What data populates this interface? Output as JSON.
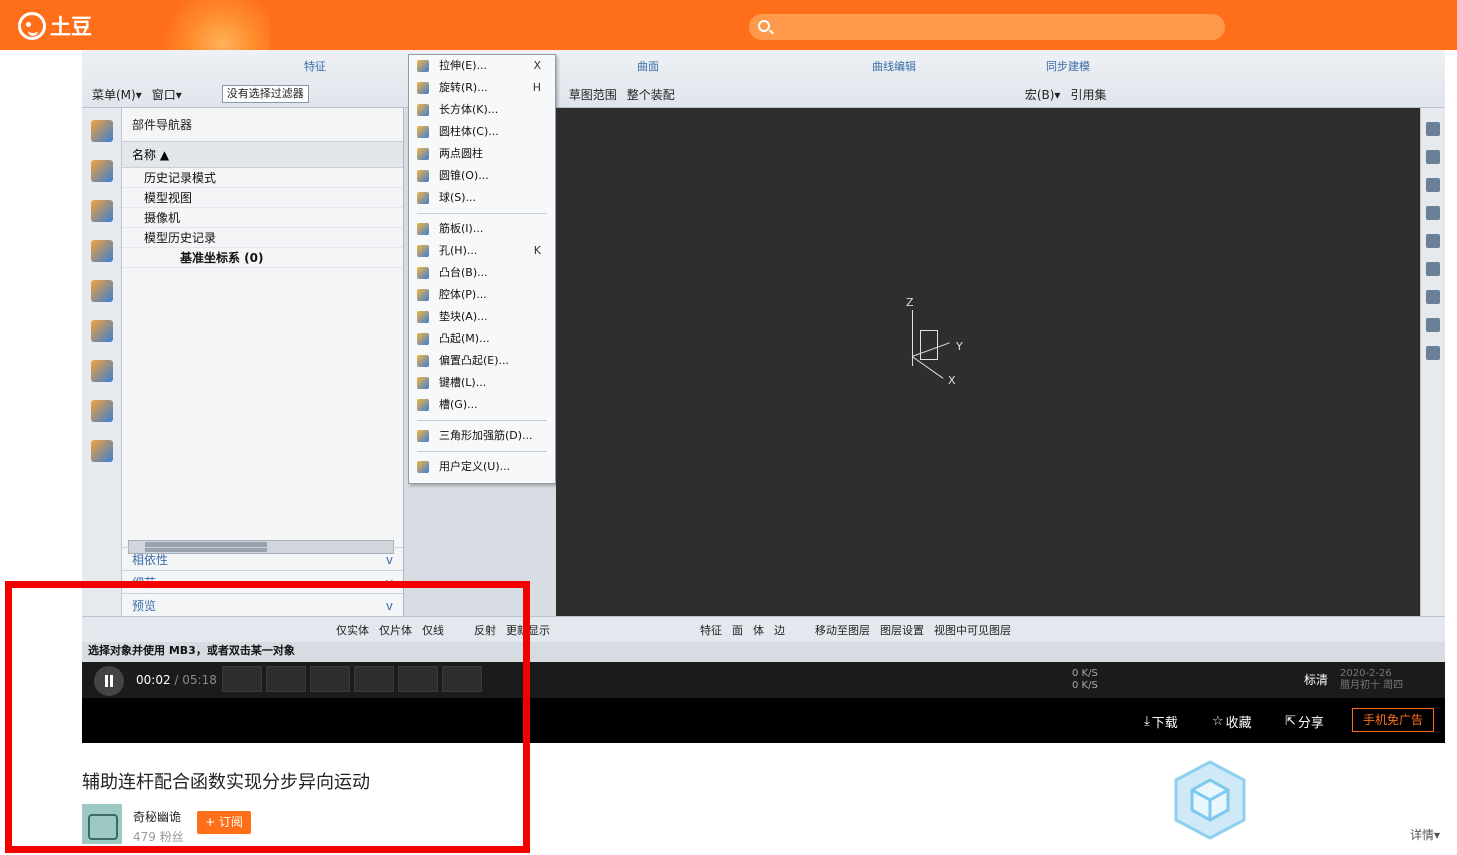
{
  "header": {
    "logo_text": "土豆",
    "search_placeholder": ""
  },
  "cad": {
    "ribbon_groups": [
      "特征",
      "曲面",
      "曲线编辑",
      "同步建模"
    ],
    "toolbar": {
      "menu": "菜单(M)▾",
      "window": "窗口▾",
      "filter": "没有选择过滤器",
      "sketch_range": "草图范围",
      "assembly": "整个装配",
      "macro": "宏(B)▾",
      "ref": "引用集"
    },
    "navigator": {
      "title": "部件导航器",
      "column": "名称",
      "rows": [
        "历史记录模式",
        "模型视图",
        "摄像机",
        "模型历史记录",
        "基准坐标系 (0)"
      ],
      "sections": [
        "相依性",
        "细节",
        "预览"
      ]
    },
    "menu_items": [
      {
        "label": "拉伸(E)...",
        "key": "X"
      },
      {
        "label": "旋转(R)...",
        "key": "H"
      },
      {
        "label": "长方体(K)...",
        "key": ""
      },
      {
        "label": "圆柱体(C)...",
        "key": ""
      },
      {
        "label": "两点圆柱",
        "key": ""
      },
      {
        "label": "圆锥(O)...",
        "key": ""
      },
      {
        "label": "球(S)...",
        "key": ""
      },
      {
        "label": "筋板(I)...",
        "key": ""
      },
      {
        "label": "孔(H)...",
        "key": "K"
      },
      {
        "label": "凸台(B)...",
        "key": ""
      },
      {
        "label": "腔体(P)...",
        "key": ""
      },
      {
        "label": "垫块(A)...",
        "key": ""
      },
      {
        "label": "凸起(M)...",
        "key": ""
      },
      {
        "label": "偏置凸起(E)...",
        "key": ""
      },
      {
        "label": "键槽(L)...",
        "key": ""
      },
      {
        "label": "槽(G)...",
        "key": ""
      },
      {
        "label": "三角形加强筋(D)...",
        "key": ""
      },
      {
        "label": "用户定义(U)...",
        "key": ""
      }
    ],
    "axes": {
      "z": "Z",
      "y": "Y",
      "x": "X"
    },
    "bottom_toolbar": [
      "仅实体",
      "仅片体",
      "仅线",
      "反射",
      "更新显示",
      "特征",
      "面",
      "体",
      "边",
      "移动至图层",
      "图层设置",
      "视图中可见图层"
    ],
    "status_text": "选择对象并使用 MB3，或者双击某一对象"
  },
  "player": {
    "time_current": "00:02",
    "time_total": "/ 05:18",
    "quality": "标清",
    "net_up": "0 K/S",
    "net_down": "0 K/S",
    "clock_date": "2020-2-26",
    "clock_lunar": "腊月初十 周四",
    "actions": {
      "download": "下载",
      "favorite": "收藏",
      "share": "分享",
      "ad_free": "手机免广告"
    }
  },
  "video": {
    "title": "辅助连杆配合函数实现分步异向运动",
    "author": "奇秘幽诡",
    "fans": "479 粉丝",
    "subscribe": "+ 订阅",
    "detail": "详情▾"
  },
  "colors": {
    "brand": "#ff6f1a",
    "highlight_box": "#f40000"
  }
}
